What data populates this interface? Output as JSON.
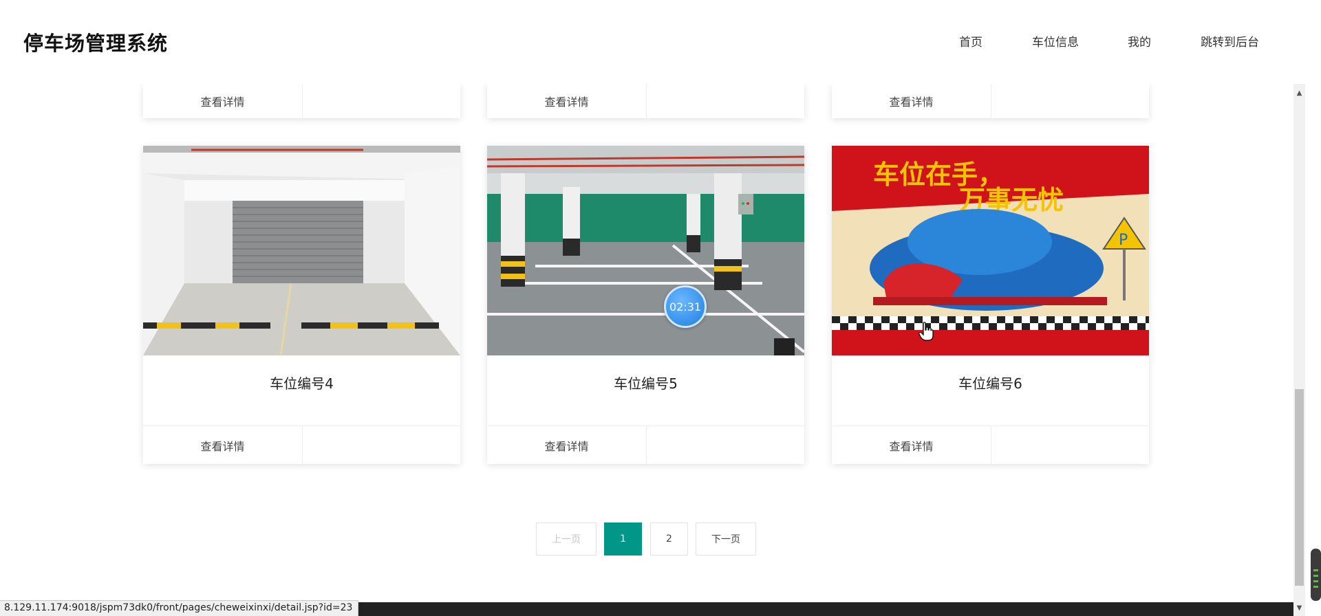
{
  "header": {
    "title": "停车场管理系统",
    "nav": [
      "首页",
      "车位信息",
      "我的",
      "跳转到后台"
    ]
  },
  "cards_top_partial": [
    {
      "detail_label": "查看详情"
    },
    {
      "detail_label": "查看详情"
    },
    {
      "detail_label": "查看详情"
    }
  ],
  "cards": [
    {
      "name": "车位编号4",
      "detail_label": "查看详情"
    },
    {
      "name": "车位编号5",
      "detail_label": "查看详情"
    },
    {
      "name": "车位编号6",
      "detail_label": "查看详情",
      "image_text_line1": "车位在手，",
      "image_text_line2": "万事无忧",
      "sign_letter": "P"
    }
  ],
  "timer_badge": "02:31",
  "pagination": {
    "prev": "上一页",
    "pages": [
      "1",
      "2"
    ],
    "current": "1",
    "next": "下一页"
  },
  "status_url": "8.129.11.174:9018/jspm73dk0/front/pages/cheweixinxi/detail.jsp?id=23",
  "colors": {
    "accent": "#009688",
    "timer": "#1f7fe0",
    "poster_red": "#d0121b"
  }
}
